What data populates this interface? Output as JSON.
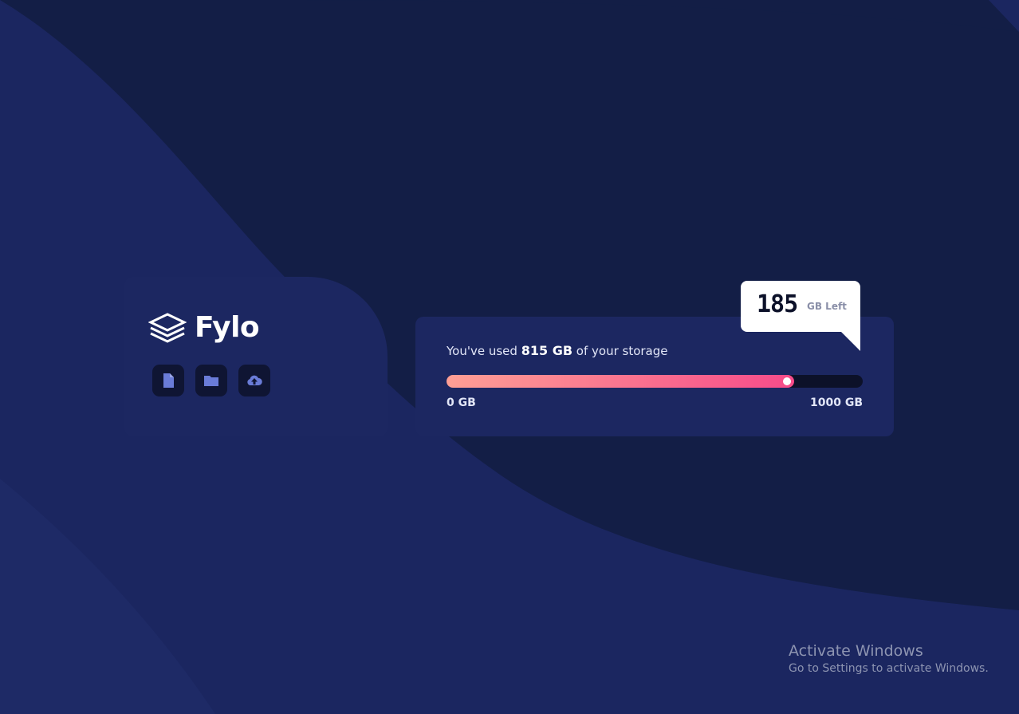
{
  "brand": {
    "name": "Fylo"
  },
  "actions": [
    {
      "icon": "document-icon"
    },
    {
      "icon": "folder-icon"
    },
    {
      "icon": "upload-icon"
    }
  ],
  "storage": {
    "prefix": "You've used",
    "used": "815 GB",
    "suffix": "of your storage",
    "used_fraction": 0.815,
    "min_label": "0 GB",
    "max_label": "1000 GB",
    "remaining": "185",
    "remaining_unit": "GB Left"
  },
  "watermark": {
    "title": "Activate Windows",
    "subtitle": "Go to Settings to activate Windows."
  },
  "colors": {
    "background": "#131e46",
    "card": "#1c2761",
    "icon_tile": "#0f1533",
    "icon": "#6a7cd8",
    "gradient_start": "#fe9f95",
    "gradient_end": "#f64b8a"
  }
}
